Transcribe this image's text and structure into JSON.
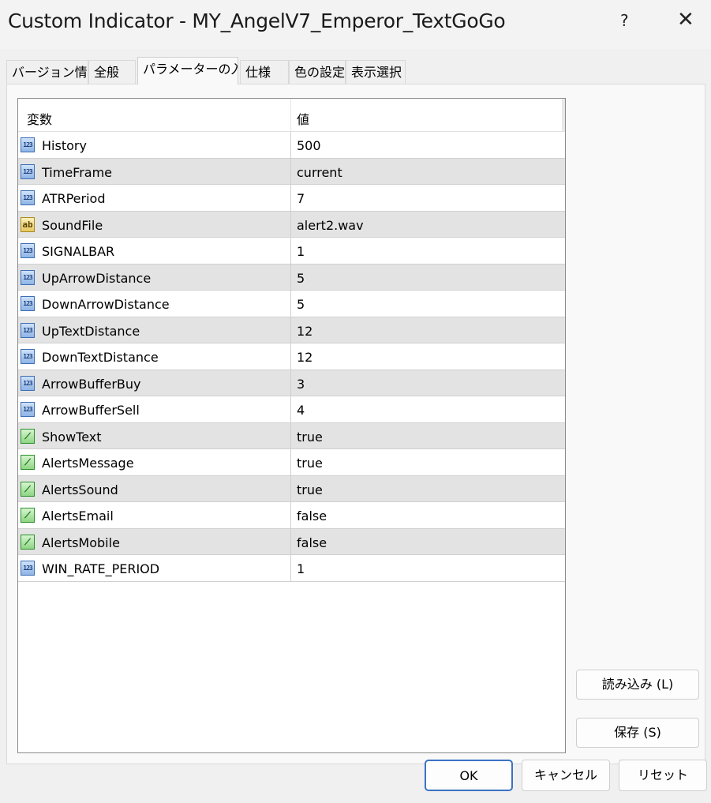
{
  "window": {
    "title": "Custom Indicator - MY_AngelV7_Emperor_TextGoGo",
    "help": "?",
    "close": "✕"
  },
  "tabs": [
    {
      "label": "バージョン情報"
    },
    {
      "label": "全般"
    },
    {
      "label": "パラメーターの入力",
      "active": true
    },
    {
      "label": "仕様"
    },
    {
      "label": "色の設定"
    },
    {
      "label": "表示選択"
    }
  ],
  "grid": {
    "header": {
      "name": "変数",
      "value": "値"
    },
    "rows": [
      {
        "type": "123",
        "name": "History",
        "value": "500"
      },
      {
        "type": "123",
        "name": "TimeFrame",
        "value": "current"
      },
      {
        "type": "123",
        "name": "ATRPeriod",
        "value": "7"
      },
      {
        "type": "ab",
        "name": "SoundFile",
        "value": "alert2.wav"
      },
      {
        "type": "123",
        "name": "SIGNALBAR",
        "value": "1"
      },
      {
        "type": "123",
        "name": "UpArrowDistance",
        "value": "5"
      },
      {
        "type": "123",
        "name": "DownArrowDistance",
        "value": "5"
      },
      {
        "type": "123",
        "name": "UpTextDistance",
        "value": "12"
      },
      {
        "type": "123",
        "name": "DownTextDistance",
        "value": "12"
      },
      {
        "type": "123",
        "name": "ArrowBufferBuy",
        "value": "3"
      },
      {
        "type": "123",
        "name": "ArrowBufferSell",
        "value": "4"
      },
      {
        "type": "bool",
        "name": "ShowText",
        "value": "true"
      },
      {
        "type": "bool",
        "name": "AlertsMessage",
        "value": "true"
      },
      {
        "type": "bool",
        "name": "AlertsSound",
        "value": "true"
      },
      {
        "type": "bool",
        "name": "AlertsEmail",
        "value": "false"
      },
      {
        "type": "bool",
        "name": "AlertsMobile",
        "value": "false"
      },
      {
        "type": "123",
        "name": "WIN_RATE_PERIOD",
        "value": "1"
      }
    ]
  },
  "buttons": {
    "load": "読み込み (L)",
    "save": "保存 (S)",
    "ok": "OK",
    "cancel": "キャンセル",
    "reset": "リセット"
  }
}
